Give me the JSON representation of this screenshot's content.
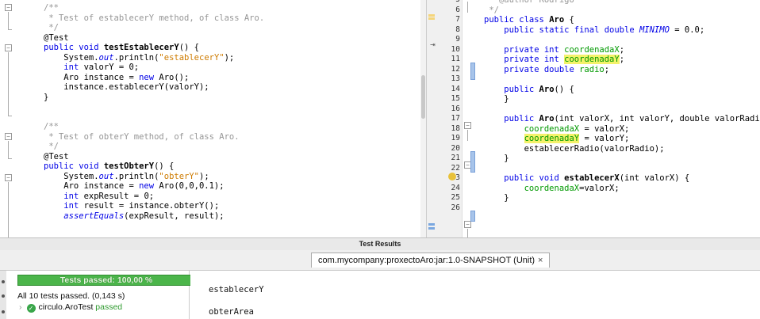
{
  "left_editor": {
    "lines": [
      {
        "k": "cm",
        "t": "/**"
      },
      {
        "k": "cm",
        "t": " * Test of establecerY method, of class Aro."
      },
      {
        "k": "cm",
        "t": " */"
      },
      {
        "k": "ann",
        "t": "@Test"
      },
      {
        "k": "sig",
        "pre": "public void ",
        "fn": "testEstablecerY",
        "post": "() {"
      },
      {
        "k": "print",
        "pre": "    System.",
        "st": "out",
        "mid": ".println(",
        "str": "\"establecerY\"",
        "post": ");"
      },
      {
        "k": "decl",
        "pre": "    ",
        "kw": "int",
        "post": " valorY = 0;"
      },
      {
        "k": "new",
        "pre": "    Aro instance = ",
        "kw": "new",
        "post": " Aro();"
      },
      {
        "k": "plain",
        "t": "    instance.establecerY(valorY);"
      },
      {
        "k": "plain",
        "t": "}"
      },
      {
        "k": "plain",
        "t": ""
      },
      {
        "k": "plain",
        "t": ""
      },
      {
        "k": "cm",
        "t": "/**"
      },
      {
        "k": "cm",
        "t": " * Test of obterY method, of class Aro."
      },
      {
        "k": "cm",
        "t": " */"
      },
      {
        "k": "ann",
        "t": "@Test"
      },
      {
        "k": "sig",
        "pre": "public void ",
        "fn": "testObterY",
        "post": "() {"
      },
      {
        "k": "print",
        "pre": "    System.",
        "st": "out",
        "mid": ".println(",
        "str": "\"obterY\"",
        "post": ");"
      },
      {
        "k": "new",
        "pre": "    Aro instance = ",
        "kw": "new",
        "post": " Aro(0,0,0.1);"
      },
      {
        "k": "decl",
        "pre": "    ",
        "kw": "int",
        "post": " expResult = 0;"
      },
      {
        "k": "decl",
        "pre": "    ",
        "kw": "int",
        "post": " result = instance.obterY();"
      },
      {
        "k": "assert",
        "pre": "    ",
        "st": "assertEquals",
        "post": "(expResult, result);"
      }
    ]
  },
  "right_editor": {
    "line_numbers": [
      "5",
      "6",
      "7",
      "8",
      "9",
      "10",
      "11",
      "12",
      "13",
      "14",
      "15",
      "16",
      "17",
      "18",
      "19",
      "20",
      "21",
      "22",
      "23",
      "24",
      "25",
      "26"
    ],
    "lines": [
      {
        "k": "cm",
        "t": " * @author Rodrigo"
      },
      {
        "k": "cm",
        "t": " */"
      },
      {
        "k": "cls",
        "kw": "public class ",
        "fn": "Aro",
        "post": " {"
      },
      {
        "k": "const",
        "kw": "    public static final double ",
        "st": "MINIMO",
        "post": " = 0.0;"
      },
      {
        "k": "plain",
        "t": ""
      },
      {
        "k": "field",
        "kw": "    private int ",
        "fld": "coordenadaX",
        "post": ";"
      },
      {
        "k": "fieldhl",
        "kw": "    private int ",
        "fld": "coordenadaY",
        "post": ";"
      },
      {
        "k": "field",
        "kw": "    private double ",
        "fld": "radio",
        "post": ";"
      },
      {
        "k": "plain",
        "t": ""
      },
      {
        "k": "ctor",
        "kw": "    public ",
        "fn": "Aro",
        "post": "() {"
      },
      {
        "k": "plain",
        "t": "    }"
      },
      {
        "k": "plain",
        "t": ""
      },
      {
        "k": "ctor2",
        "kw": "    public ",
        "fn": "Aro",
        "post": "(int valorX, int valorY, double valorRadio"
      },
      {
        "k": "assign",
        "pre": "        ",
        "fld": "coordenadaX",
        "post": " = valorX;"
      },
      {
        "k": "assignhl",
        "pre": "        ",
        "fld": "coordenadaY",
        "post": " = valorY;"
      },
      {
        "k": "plain",
        "t": "        establecerRadio(valorRadio);"
      },
      {
        "k": "plain",
        "t": "    }"
      },
      {
        "k": "plain",
        "t": ""
      },
      {
        "k": "ctor",
        "kw": "    public void ",
        "fn": "establecerX",
        "post": "(int valorX) {"
      },
      {
        "k": "assign",
        "pre": "        ",
        "fld": "coordenadaX",
        "post": "=valorX;"
      },
      {
        "k": "plain",
        "t": "    }"
      },
      {
        "k": "plain",
        "t": ""
      }
    ]
  },
  "results": {
    "title": "Test Results",
    "tab_label": "com.mycompany:proxectoAro:jar:1.0-SNAPSHOT (Unit)",
    "tab_close": "×",
    "progress_label": "Tests passed: 100,00 %",
    "progress_fraction": 1.0,
    "summary": "All 10 tests passed. (0,143 s)",
    "tree_item": "circulo.AroTest",
    "tree_status": "passed",
    "output_lines": [
      "establecerY",
      "obterArea"
    ]
  }
}
